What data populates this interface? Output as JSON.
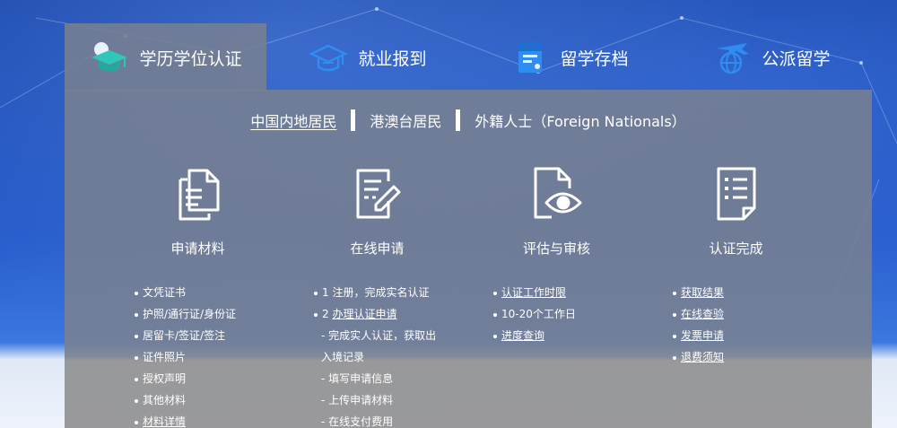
{
  "tabs": [
    {
      "label": "学历学位认证",
      "icon": "graduation-cap-icon",
      "active": true
    },
    {
      "label": "就业报到",
      "icon": "mortarboard-icon",
      "active": false
    },
    {
      "label": "留学存档",
      "icon": "archive-document-icon",
      "active": false
    },
    {
      "label": "公派留学",
      "icon": "plane-globe-icon",
      "active": false
    }
  ],
  "subtabs": [
    {
      "label": "中国内地居民",
      "active": true
    },
    {
      "label": "港澳台居民",
      "active": false
    },
    {
      "label": "外籍人士（Foreign Nationals）",
      "active": false
    }
  ],
  "steps": [
    {
      "title": "申请材料",
      "icon": "documents-icon"
    },
    {
      "title": "在线申请",
      "icon": "edit-form-icon"
    },
    {
      "title": "评估与审核",
      "icon": "document-eye-icon"
    },
    {
      "title": "认证完成",
      "icon": "checklist-icon"
    }
  ],
  "lists": {
    "materials": [
      {
        "text": "文凭证书",
        "link": false
      },
      {
        "text": "护照/通行证/身份证",
        "link": false
      },
      {
        "text": "居留卡/签证/签注",
        "link": false
      },
      {
        "text": "证件照片",
        "link": false
      },
      {
        "text": "授权声明",
        "link": false
      },
      {
        "text": "其他材料",
        "link": false
      },
      {
        "text": "材料详情",
        "link": true
      }
    ],
    "online": {
      "item1": "1 注册，完成实名认证",
      "item2_prefix": "2 ",
      "item2_link": "办理认证申请",
      "sub1_line1": "- 完成实人认证，获取出",
      "sub1_line2": "入境记录",
      "sub2": "- 填写申请信息",
      "sub3": "- 上传申请材料",
      "sub4": "- 在线支付费用"
    },
    "review": [
      {
        "text": "认证工作时限",
        "link": true
      },
      {
        "text": "10-20个工作日",
        "link": false
      },
      {
        "text": "进度查询",
        "link": true
      }
    ],
    "complete": [
      {
        "text": "获取结果",
        "link": true
      },
      {
        "text": "在线查验",
        "link": true
      },
      {
        "text": "发票申请",
        "link": true
      },
      {
        "text": "退费须知",
        "link": true
      }
    ]
  },
  "colors": {
    "accent_teal": "#2fc7b9",
    "accent_blue": "#2f8cf0",
    "background": "#1f4fb6"
  }
}
